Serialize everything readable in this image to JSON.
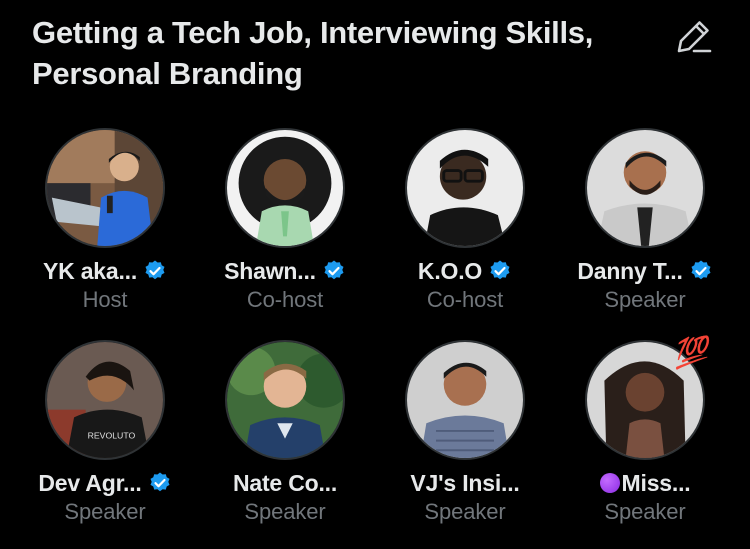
{
  "space": {
    "title": "Getting a Tech Job, Interviewing Skills, Personal Branding",
    "edit_icon": "pencil-icon"
  },
  "colors": {
    "background": "#000000",
    "text": "#e7e9ea",
    "secondary_text": "#71767b",
    "verified": "#1d9bf0"
  },
  "participants": [
    {
      "name": "YK aka...",
      "role": "Host",
      "verified": true
    },
    {
      "name": "Shawn...",
      "role": "Co-host",
      "verified": true
    },
    {
      "name": "K.O.O",
      "role": "Co-host",
      "verified": true
    },
    {
      "name": "Danny T...",
      "role": "Speaker",
      "verified": true
    },
    {
      "name": "Dev Agr...",
      "role": "Speaker",
      "verified": true
    },
    {
      "name": "Nate Co...",
      "role": "Speaker",
      "verified": false
    },
    {
      "name": "VJ's Insi...",
      "role": "Speaker",
      "verified": false
    },
    {
      "name": "Miss...",
      "role": "Speaker",
      "verified": false,
      "emoji_prefix": "purple-circle",
      "reaction": "💯"
    }
  ]
}
